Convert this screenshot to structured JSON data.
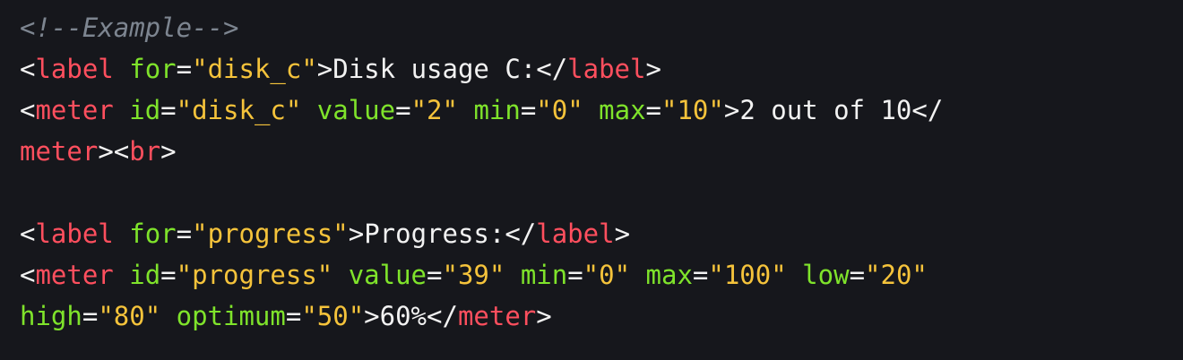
{
  "lines": [
    [
      {
        "text": "<!--Example-->",
        "type": "comment"
      }
    ],
    [
      {
        "text": "<",
        "type": "punct"
      },
      {
        "text": "label",
        "type": "tag"
      },
      {
        "text": " ",
        "type": "text"
      },
      {
        "text": "for",
        "type": "attr"
      },
      {
        "text": "=",
        "type": "punct"
      },
      {
        "text": "\"disk_c\"",
        "type": "string"
      },
      {
        "text": ">",
        "type": "punct"
      },
      {
        "text": "Disk usage C:",
        "type": "text"
      },
      {
        "text": "</",
        "type": "punct"
      },
      {
        "text": "label",
        "type": "tag"
      },
      {
        "text": ">",
        "type": "punct"
      }
    ],
    [
      {
        "text": "<",
        "type": "punct"
      },
      {
        "text": "meter",
        "type": "tag"
      },
      {
        "text": " ",
        "type": "text"
      },
      {
        "text": "id",
        "type": "attr"
      },
      {
        "text": "=",
        "type": "punct"
      },
      {
        "text": "\"disk_c\"",
        "type": "string"
      },
      {
        "text": " ",
        "type": "text"
      },
      {
        "text": "value",
        "type": "attr"
      },
      {
        "text": "=",
        "type": "punct"
      },
      {
        "text": "\"2\"",
        "type": "string"
      },
      {
        "text": " ",
        "type": "text"
      },
      {
        "text": "min",
        "type": "attr"
      },
      {
        "text": "=",
        "type": "punct"
      },
      {
        "text": "\"0\"",
        "type": "string"
      },
      {
        "text": " ",
        "type": "text"
      },
      {
        "text": "max",
        "type": "attr"
      },
      {
        "text": "=",
        "type": "punct"
      },
      {
        "text": "\"10\"",
        "type": "string"
      },
      {
        "text": ">",
        "type": "punct"
      },
      {
        "text": "2 out of 10",
        "type": "text"
      },
      {
        "text": "</",
        "type": "punct"
      }
    ],
    [
      {
        "text": "meter",
        "type": "tag"
      },
      {
        "text": "><",
        "type": "punct"
      },
      {
        "text": "br",
        "type": "tag"
      },
      {
        "text": ">",
        "type": "punct"
      }
    ],
    [],
    [
      {
        "text": "<",
        "type": "punct"
      },
      {
        "text": "label",
        "type": "tag"
      },
      {
        "text": " ",
        "type": "text"
      },
      {
        "text": "for",
        "type": "attr"
      },
      {
        "text": "=",
        "type": "punct"
      },
      {
        "text": "\"progress\"",
        "type": "string"
      },
      {
        "text": ">",
        "type": "punct"
      },
      {
        "text": "Progress:",
        "type": "text"
      },
      {
        "text": "</",
        "type": "punct"
      },
      {
        "text": "label",
        "type": "tag"
      },
      {
        "text": ">",
        "type": "punct"
      }
    ],
    [
      {
        "text": "<",
        "type": "punct"
      },
      {
        "text": "meter",
        "type": "tag"
      },
      {
        "text": " ",
        "type": "text"
      },
      {
        "text": "id",
        "type": "attr"
      },
      {
        "text": "=",
        "type": "punct"
      },
      {
        "text": "\"progress\"",
        "type": "string"
      },
      {
        "text": " ",
        "type": "text"
      },
      {
        "text": "value",
        "type": "attr"
      },
      {
        "text": "=",
        "type": "punct"
      },
      {
        "text": "\"39\"",
        "type": "string"
      },
      {
        "text": " ",
        "type": "text"
      },
      {
        "text": "min",
        "type": "attr"
      },
      {
        "text": "=",
        "type": "punct"
      },
      {
        "text": "\"0\"",
        "type": "string"
      },
      {
        "text": " ",
        "type": "text"
      },
      {
        "text": "max",
        "type": "attr"
      },
      {
        "text": "=",
        "type": "punct"
      },
      {
        "text": "\"100\"",
        "type": "string"
      },
      {
        "text": " ",
        "type": "text"
      },
      {
        "text": "low",
        "type": "attr"
      },
      {
        "text": "=",
        "type": "punct"
      },
      {
        "text": "\"20\"",
        "type": "string"
      }
    ],
    [
      {
        "text": "high",
        "type": "attr"
      },
      {
        "text": "=",
        "type": "punct"
      },
      {
        "text": "\"80\"",
        "type": "string"
      },
      {
        "text": " ",
        "type": "text"
      },
      {
        "text": "optimum",
        "type": "attr"
      },
      {
        "text": "=",
        "type": "punct"
      },
      {
        "text": "\"50\"",
        "type": "string"
      },
      {
        "text": ">",
        "type": "punct"
      },
      {
        "text": "60%",
        "type": "text"
      },
      {
        "text": "</",
        "type": "punct"
      },
      {
        "text": "meter",
        "type": "tag"
      },
      {
        "text": ">",
        "type": "punct"
      }
    ]
  ]
}
